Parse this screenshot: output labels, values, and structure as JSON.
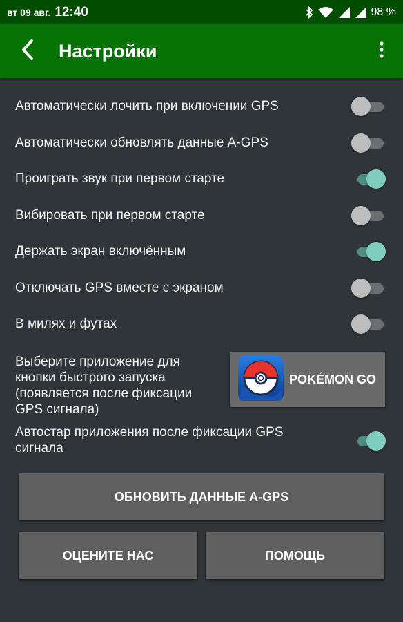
{
  "status_bar": {
    "date": "вт 09 авг.",
    "time": "12:40",
    "battery": "98 %",
    "icons": [
      "bluetooth-icon",
      "wifi-icon",
      "signal-icon",
      "signal-icon",
      "battery-icon"
    ]
  },
  "app_bar": {
    "title": "Настройки",
    "back_icon": "chevron-left-icon",
    "menu_icon": "more-vert-icon",
    "color": "#077307"
  },
  "settings": [
    {
      "label": "Автоматически лочить при включении GPS",
      "on": false
    },
    {
      "label": "Автоматически обновлять данные A-GPS",
      "on": false
    },
    {
      "label": "Проиграть звук при первом старте",
      "on": true
    },
    {
      "label": "Вибировать при первом старте",
      "on": false
    },
    {
      "label": "Держать экран включённым",
      "on": true
    },
    {
      "label": "Отключать GPS вместе с экраном",
      "on": false
    },
    {
      "label": "В милях и футах",
      "on": false
    }
  ],
  "quick_launch": {
    "label": "Выберите приложение для кнопки быстрого запуска (появляется после фиксации GPS сигнала)",
    "app_name": "POKÉMON GO",
    "app_icon": "pokeball-icon"
  },
  "autostart": {
    "label": "Автостар приложения после фиксации GPS сигнала",
    "on": true
  },
  "buttons": {
    "update_agps": "ОБНОВИТЬ ДАННЫЕ A-GPS",
    "rate": "ОЦЕНИТЕ НАС",
    "help": "ПОМОЩЬ"
  },
  "colors": {
    "background": "#303539",
    "switch_on": "#7fcdbe",
    "switch_off": "#bdbdbd"
  }
}
